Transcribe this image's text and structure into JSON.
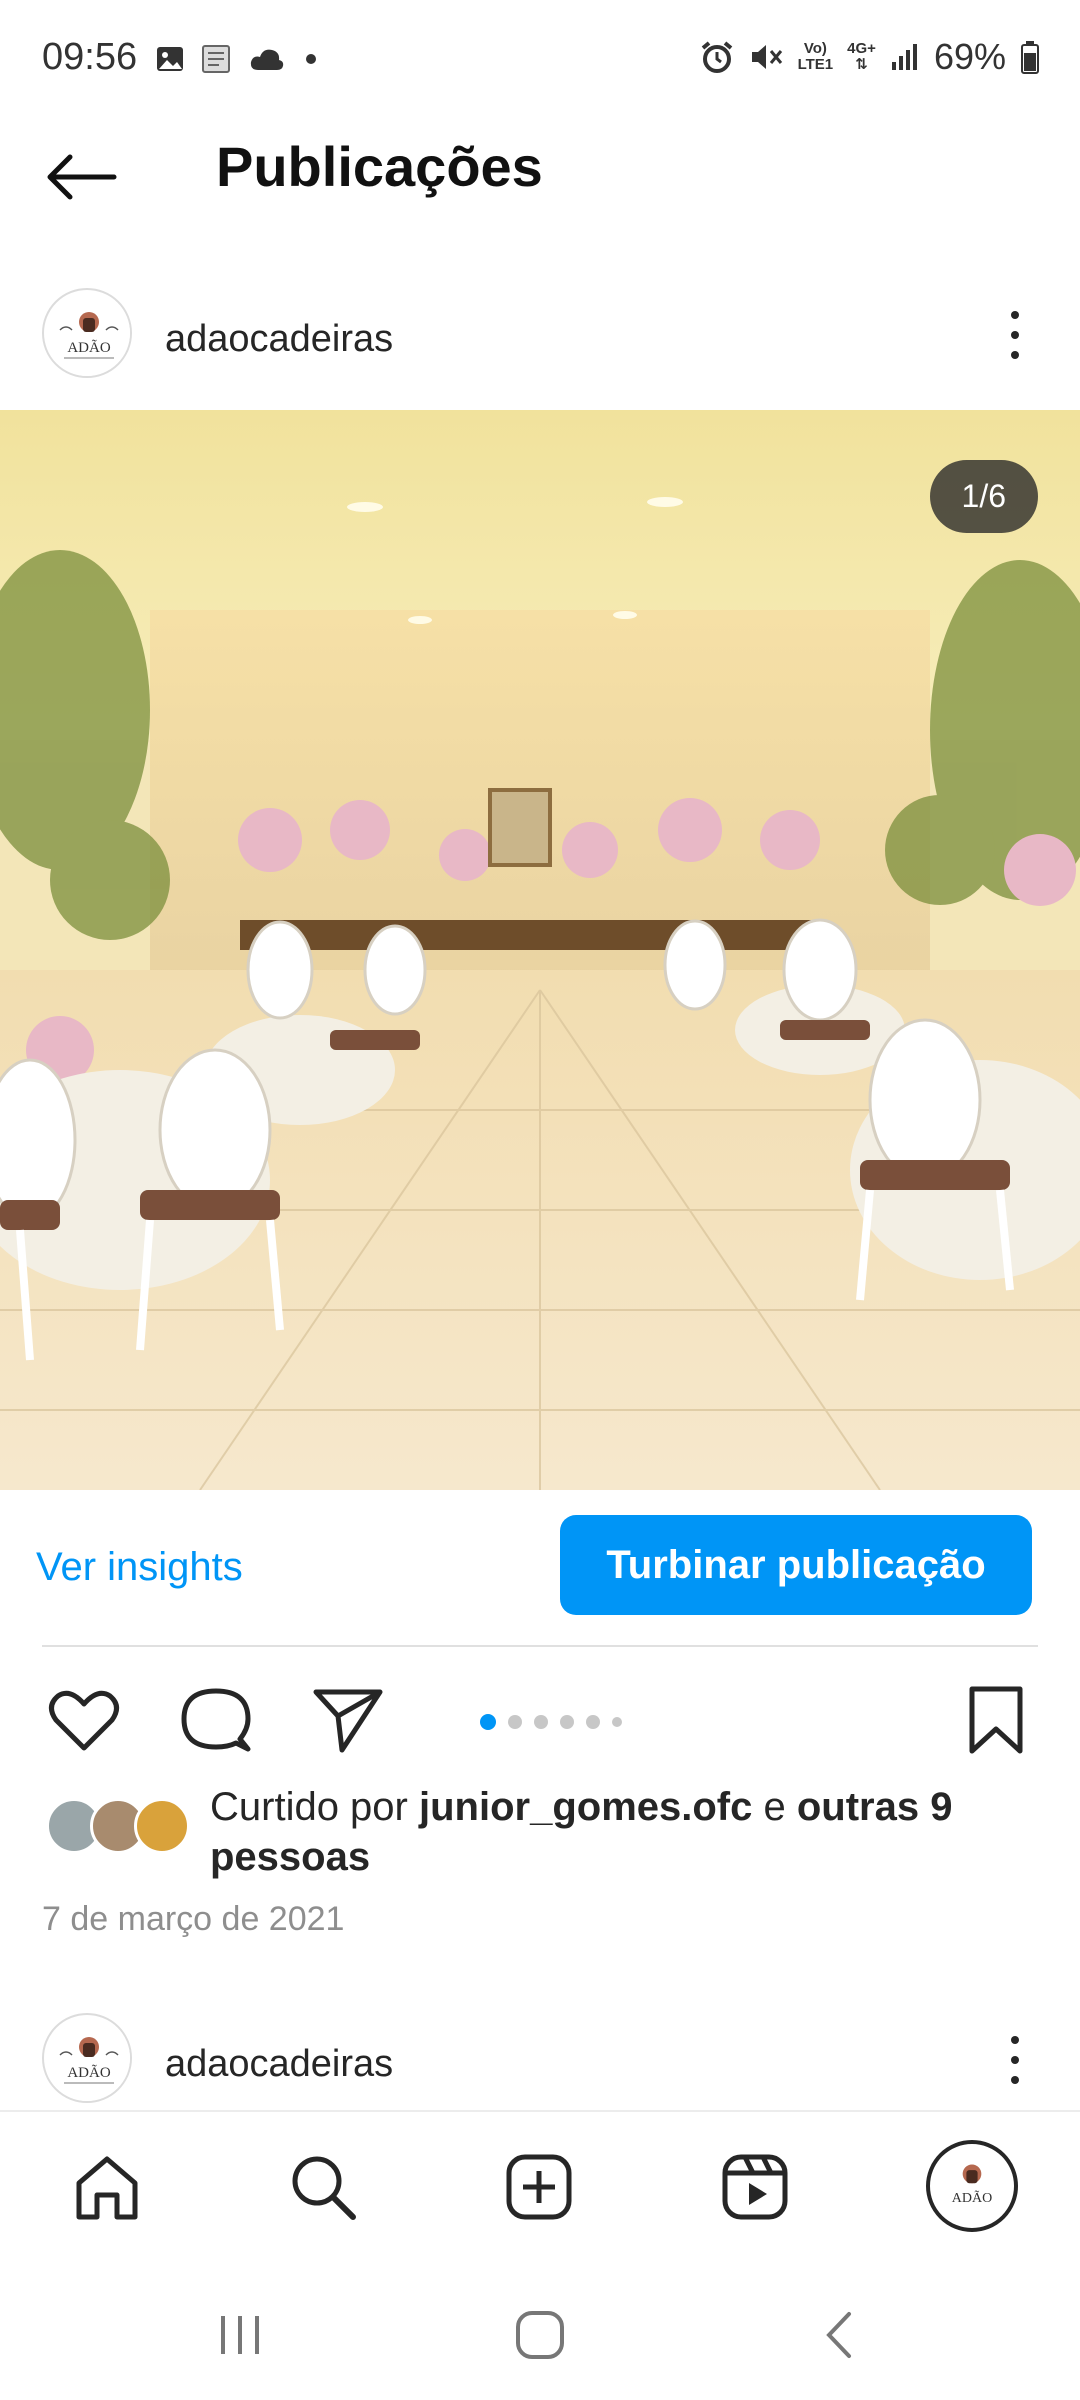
{
  "status_bar": {
    "time": "09:56",
    "left_icons": [
      "gallery-icon",
      "document-icon",
      "cloud-icon",
      "notification-dot-icon"
    ],
    "network_top": "Vo)",
    "network_bottom": "LTE1",
    "data_type": "4G+",
    "battery": "69%",
    "right_icons": [
      "alarm-icon",
      "mute-icon",
      "signal-icon",
      "battery-icon"
    ]
  },
  "header": {
    "title": "Publicações",
    "back_icon": "arrow-left-icon"
  },
  "post": {
    "username": "adaocadeiras",
    "avatar_logo_text": "ADÃO",
    "image_counter": "1/6",
    "image_description_icon": "event-hall-photo",
    "current_slide": 1,
    "total_slides": 6,
    "insights_label": "Ver insights",
    "boost_label": "Turbinar publicação",
    "likes_prefix": "Curtido por ",
    "likes_user": "junior_gomes.ofc",
    "likes_connector": " e ",
    "likes_others": "outras 9 pessoas",
    "date": "7 de março de 2021"
  },
  "next_post": {
    "username": "adaocadeiras"
  },
  "bottom_nav": {
    "items": [
      "home-icon",
      "search-icon",
      "create-icon",
      "reels-icon",
      "profile-avatar"
    ]
  },
  "colors": {
    "accent": "#0095f6",
    "text": "#262626",
    "muted": "#8e8e8e"
  }
}
